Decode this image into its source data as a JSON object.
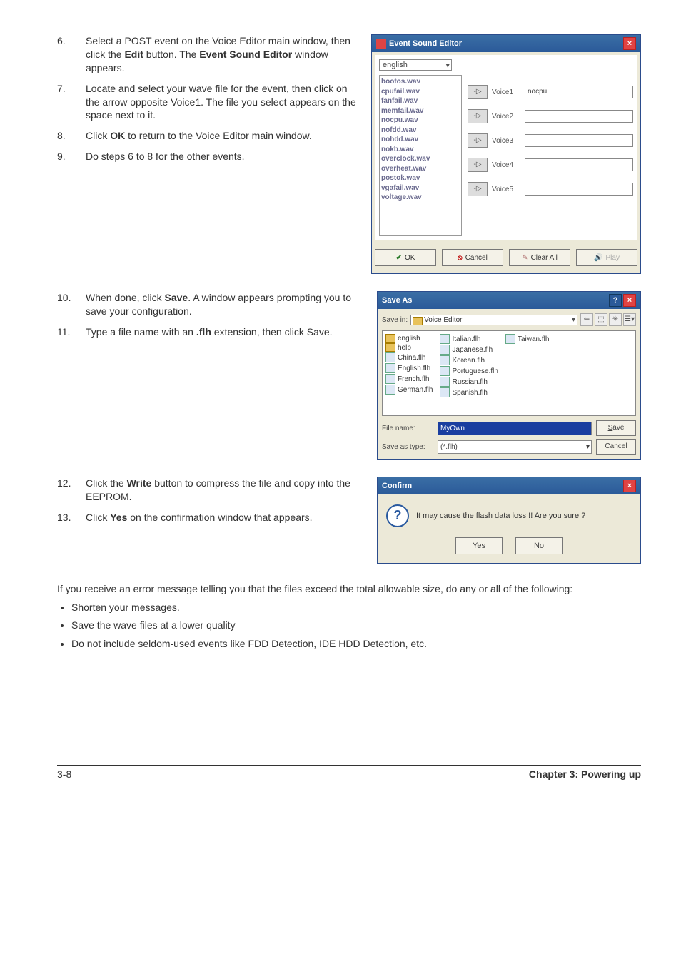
{
  "steps_a": [
    {
      "num": "6.",
      "txt_pre": "Select a POST event on the Voice Editor main window, then click the ",
      "bold1": "Edit",
      "mid": " button. The ",
      "bold2": "Event Sound Editor",
      "post": " window appears."
    },
    {
      "num": "7.",
      "txt": "Locate and select your wave file for the event, then click on the arrow opposite Voice1. The file you select appears on the space next to it."
    },
    {
      "num": "8.",
      "txt_pre": "Click ",
      "bold1": "OK",
      "post": " to return to the Voice Editor main window."
    },
    {
      "num": "9.",
      "txt": "Do steps 6 to 8 for the other events."
    }
  ],
  "steps_b": [
    {
      "num": "10.",
      "txt_pre": "When done, click ",
      "bold1": "Save",
      "post": ". A window appears prompting you to save your configuration."
    },
    {
      "num": "11.",
      "txt_pre": "Type a file name with an ",
      "bold1": ".flh",
      "post": " extension, then click Save."
    }
  ],
  "steps_c": [
    {
      "num": "12.",
      "txt_pre": "Click the ",
      "bold1": "Write",
      "post": " button to compress the file and copy into the EEPROM."
    },
    {
      "num": "13.",
      "txt_pre": "Click ",
      "bold1": "Yes",
      "post": " on the confirmation window that appears."
    }
  ],
  "ese": {
    "title": "Event Sound Editor",
    "lang": "english",
    "wavs": [
      "bootos.wav",
      "cpufail.wav",
      "fanfail.wav",
      "memfail.wav",
      "nocpu.wav",
      "nofdd.wav",
      "nohdd.wav",
      "nokb.wav",
      "overclock.wav",
      "overheat.wav",
      "postok.wav",
      "vgafail.wav",
      "voltage.wav"
    ],
    "voices": [
      {
        "label": "Voice1",
        "value": "nocpu"
      },
      {
        "label": "Voice2",
        "value": ""
      },
      {
        "label": "Voice3",
        "value": ""
      },
      {
        "label": "Voice4",
        "value": ""
      },
      {
        "label": "Voice5",
        "value": ""
      }
    ],
    "btn_ok": "OK",
    "btn_cancel": "Cancel",
    "btn_clear": "Clear All",
    "btn_play": "Play"
  },
  "saveas": {
    "title": "Save As",
    "savein_label": "Save in:",
    "savein_value": "Voice Editor",
    "folders": [
      "english",
      "help"
    ],
    "files_col1": [
      "China.flh",
      "English.flh",
      "French.flh",
      "German.flh"
    ],
    "files_col2": [
      "Italian.flh",
      "Japanese.flh",
      "Korean.flh",
      "Portuguese.flh",
      "Russian.flh",
      "Spanish.flh"
    ],
    "files_col3": [
      "Taiwan.flh"
    ],
    "filename_label": "File name:",
    "filename_value": "MyOwn",
    "savetype_label": "Save as type:",
    "savetype_value": "(*.flh)",
    "btn_save": "Save",
    "btn_cancel": "Cancel"
  },
  "confirm": {
    "title": "Confirm",
    "msg": "It may cause the flash data loss !!  Are you sure ?",
    "yes": "Yes",
    "no": "No"
  },
  "post_paragraph": "If you receive an error message telling you that the files exceed the total allowable size, do any or all of the following:",
  "bullets": [
    "Shorten your messages.",
    "Save the wave files at a lower quality",
    "Do not include seldom-used events like FDD Detection, IDE HDD Detection, etc."
  ],
  "footer_left": "3-8",
  "footer_right": "Chapter 3: Powering up"
}
